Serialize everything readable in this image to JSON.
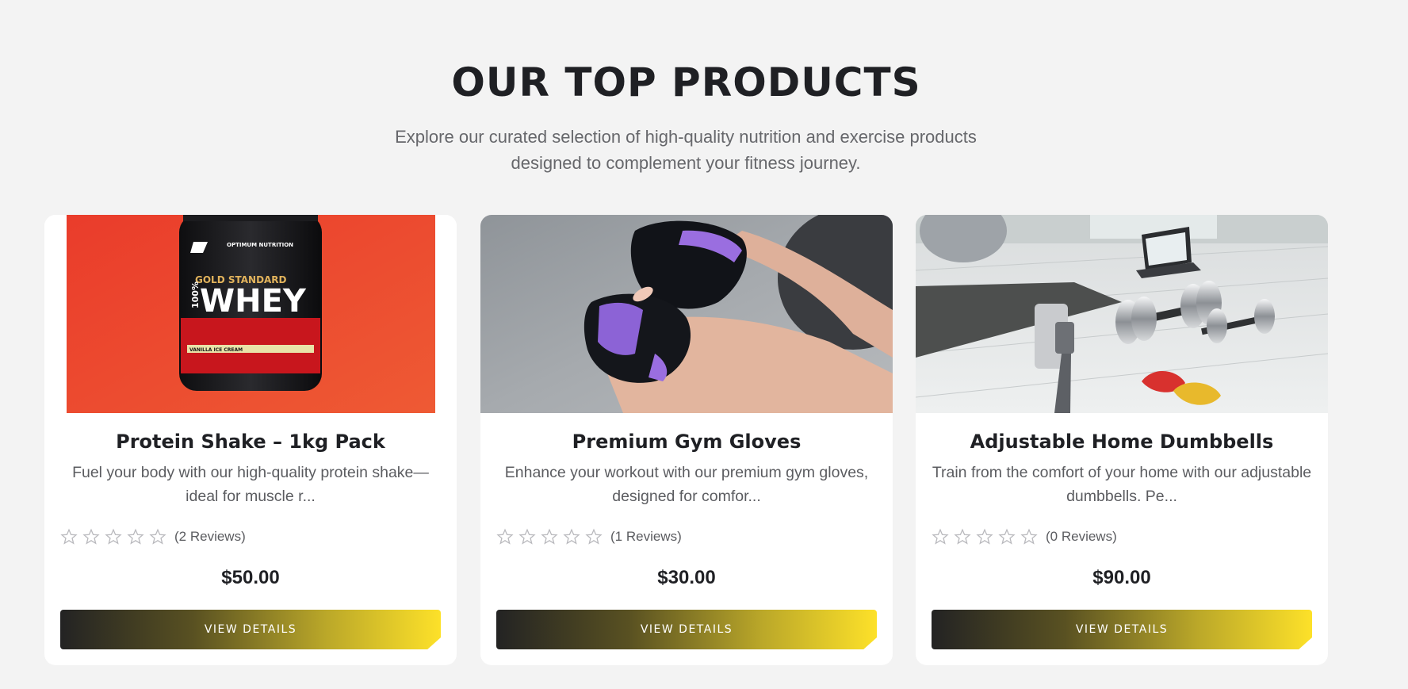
{
  "section": {
    "title": "OUR TOP PRODUCTS",
    "subtitle": "Explore our curated selection of high-quality nutrition and exercise products designed to complement your fitness journey."
  },
  "products": [
    {
      "name": "Protein Shake – 1kg Pack",
      "description": "Fuel your body with our high-quality protein shake—ideal for muscle r...",
      "rating": 0,
      "reviews": "(2 Reviews)",
      "price": "$50.00",
      "button_label": "VIEW DETAILS",
      "image_icon": "protein-tub-image",
      "tub_text": {
        "brand": "OPTIMUM NUTRITION",
        "line1": "GOLD STANDARD",
        "line2": "100%",
        "line3": "WHEY",
        "flavor": "VANILLA ICE CREAM"
      }
    },
    {
      "name": "Premium Gym Gloves",
      "description": "Enhance your workout with our premium gym gloves, designed for comfor...",
      "rating": 0,
      "reviews": "(1 Reviews)",
      "price": "$30.00",
      "button_label": "VIEW DETAILS",
      "image_icon": "gym-gloves-image"
    },
    {
      "name": "Adjustable Home Dumbbells",
      "description": "Train from the comfort of your home with our adjustable dumbbells. Pe...",
      "rating": 0,
      "reviews": "(0 Reviews)",
      "price": "$90.00",
      "button_label": "VIEW DETAILS",
      "image_icon": "home-dumbbells-image"
    }
  ],
  "colors": {
    "background": "#f3f3f3",
    "card": "#ffffff",
    "button_gradient_start": "#232323",
    "button_gradient_end": "#fde129",
    "star_outline": "#b9b9bd"
  }
}
